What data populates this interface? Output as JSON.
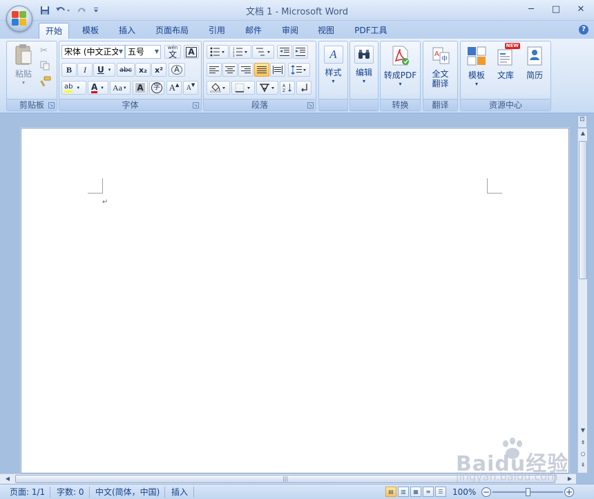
{
  "title": "文档 1 - Microsoft Word",
  "window_controls": {
    "minimize": "─",
    "maximize": "□",
    "close": "✕"
  },
  "qat": {
    "save_icon": "save-icon",
    "undo_icon": "undo-icon",
    "redo_icon": "redo-icon",
    "customize_icon": "dropdown-icon"
  },
  "tabs": [
    "开始",
    "模板",
    "插入",
    "页面布局",
    "引用",
    "邮件",
    "审阅",
    "视图",
    "PDF工具"
  ],
  "active_tab": "开始",
  "groups": {
    "clipboard": {
      "label": "剪贴板",
      "paste": "粘贴"
    },
    "font": {
      "label": "字体",
      "font_name": "宋体 (中文正文",
      "font_size": "五号",
      "pinyin": "wén",
      "char_border": "A",
      "bold": "B",
      "italic": "I",
      "underline": "U",
      "strike": "abc",
      "sub": "x₂",
      "sup": "x²",
      "clear": "A",
      "highlight": "ab",
      "font_color": "A",
      "case": "Aa",
      "shade": "A",
      "enclose": "字",
      "grow": "A",
      "shrink": "A"
    },
    "paragraph": {
      "label": "段落"
    },
    "styles": {
      "label": "样式",
      "sym": "A"
    },
    "edit": {
      "label": "编辑",
      "sym": "M"
    },
    "convert": {
      "label": "转换",
      "button": "转成PDF"
    },
    "translate": {
      "label": "翻译",
      "button_line1": "全文",
      "button_line2": "翻译"
    },
    "resource": {
      "label": "资源中心",
      "template": "模板",
      "library": "文库",
      "resume": "简历",
      "new_badge": "NEW"
    }
  },
  "document": {
    "paragraph_mark": "↵"
  },
  "status": {
    "page": "页面: 1/1",
    "words": "字数: 0",
    "language": "中文(简体，中国)",
    "mode": "插入",
    "zoom": "100%",
    "zoom_level": 0.5
  },
  "watermark": {
    "brand": "Baidu经验",
    "url": "jingyan.baidu.com"
  },
  "colors": {
    "accent": "#15428b",
    "highlight": "#ffc25c",
    "font_red": "#e00000",
    "marker_yellow": "#ffff00"
  }
}
